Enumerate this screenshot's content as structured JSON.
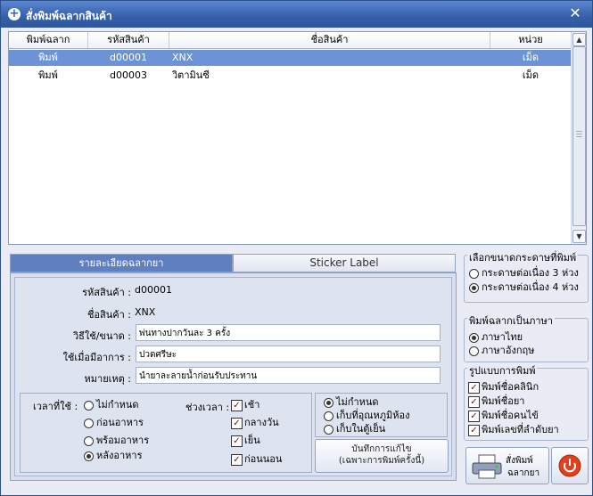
{
  "window": {
    "title": "สั่งพิมพ์ฉลากสินค้า",
    "close_glyph": "✕"
  },
  "grid": {
    "columns": [
      "พิมพ์ฉลาก",
      "รหัสสินค้า",
      "ชื่อสินค้า",
      "หน่วย"
    ],
    "rows": [
      {
        "print": "พิมพ์",
        "code": "d00001",
        "name": "XNX",
        "unit": "เม็ด",
        "selected": true
      },
      {
        "print": "พิมพ์",
        "code": "d00003",
        "name": "วิตามินซี",
        "unit": "เม็ด",
        "selected": false
      }
    ]
  },
  "tabs": [
    "รายละเอียดฉลากยา",
    "Sticker Label"
  ],
  "detail": {
    "code_label": "รหัสสินค้า :",
    "code_value": "d00001",
    "name_label": "ชื่อสินค้า :",
    "name_value": "XNX",
    "usage_label": "วิธีใช้/ขนาด :",
    "usage_value": "พ่นทางปากวันละ 3 ครั้ง",
    "symptom_label": "ใช้เมื่อมีอาการ :",
    "symptom_value": "ปวดศรีษะ",
    "note_label": "หมายเหตุ :",
    "note_value": "นํายาละลายน้ำก่อนรับประทาน"
  },
  "time_use": {
    "label": "เวลาที่ใช้ :",
    "options": [
      "ไม่กำหนด",
      "ก่อนอาหาร",
      "พร้อมอาหาร",
      "หลังอาหาร"
    ],
    "selected_index": 3
  },
  "period": {
    "label": "ช่วงเวลา :",
    "options": [
      "เช้า",
      "กลางวัน",
      "เย็น",
      "ก่อนนอน"
    ]
  },
  "storage": {
    "options": [
      "ไม่กำหนด",
      "เก็บที่อุณหภูมิห้อง",
      "เก็บในตู้เย็น"
    ],
    "selected_index": 0
  },
  "save_button": {
    "line1": "บันทึกการแก้ไข",
    "line2": "(เฉพาะการพิมพ์ครั้งนี้)"
  },
  "paper_size": {
    "title": "เลือกขนาดกระดาษที่พิมพ์",
    "options": [
      "กระดาษต่อเนื่อง 3 ห่วง",
      "กระดาษต่อเนื่อง 4 ห่วง"
    ],
    "selected_index": 1
  },
  "language": {
    "title": "พิมพ์ฉลากเป็นภาษา",
    "options": [
      "ภาษาไทย",
      "ภาษาอังกฤษ"
    ],
    "selected_index": 0
  },
  "print_format": {
    "title": "รูปแบบการพิมพ์",
    "options": [
      "พิมพ์ชื่อคลินิก",
      "พิมพ์ชื่อยา",
      "พิมพ์ชื่อคนไข้",
      "พิมพ์เลขที่ลำดับยา"
    ]
  },
  "print_button": {
    "line1": "สั่งพิมพ์",
    "line2": "ฉลากยา"
  },
  "check_glyph": "✓",
  "colors": {
    "titlebar": "#355fa9",
    "selected_row": "#6c93d6",
    "active_tab": "#5f7fbf",
    "exit_icon": "#e2401c"
  }
}
